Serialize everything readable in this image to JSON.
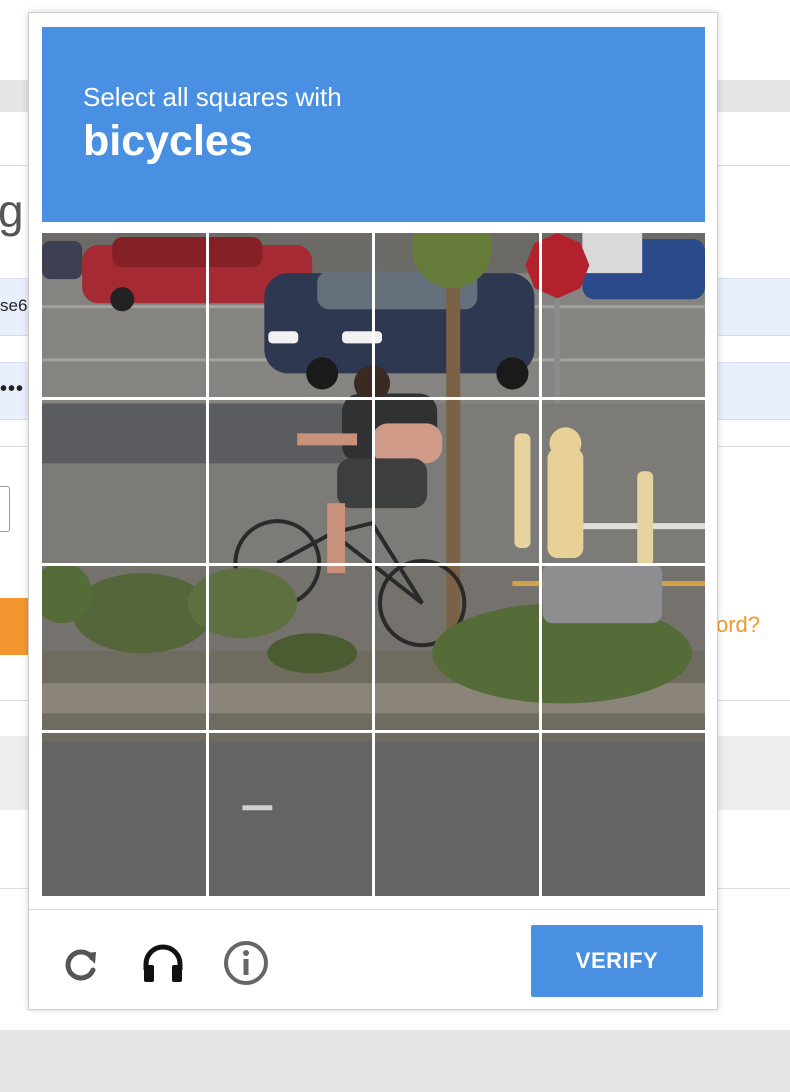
{
  "background_page": {
    "heading_fragment": "g i",
    "row1_text": "se6",
    "row2_text": "•••",
    "link_fragment": "ord?"
  },
  "captcha": {
    "prompt_line1": "Select all squares with",
    "prompt_target": "bicycles",
    "tiles": [
      {
        "row": 1,
        "col": 1
      },
      {
        "row": 1,
        "col": 2
      },
      {
        "row": 1,
        "col": 3
      },
      {
        "row": 1,
        "col": 4
      },
      {
        "row": 2,
        "col": 1
      },
      {
        "row": 2,
        "col": 2
      },
      {
        "row": 2,
        "col": 3
      },
      {
        "row": 2,
        "col": 4
      },
      {
        "row": 3,
        "col": 1
      },
      {
        "row": 3,
        "col": 2
      },
      {
        "row": 3,
        "col": 3
      },
      {
        "row": 3,
        "col": 4
      },
      {
        "row": 4,
        "col": 1
      },
      {
        "row": 4,
        "col": 2
      },
      {
        "row": 4,
        "col": 3
      },
      {
        "row": 4,
        "col": 4
      }
    ],
    "footer": {
      "icons": [
        "reload-icon",
        "headphones-icon",
        "info-icon"
      ],
      "verify_label": "VERIFY"
    }
  },
  "colors": {
    "accent_blue": "#4a90e2",
    "orange": "#f3962f"
  }
}
